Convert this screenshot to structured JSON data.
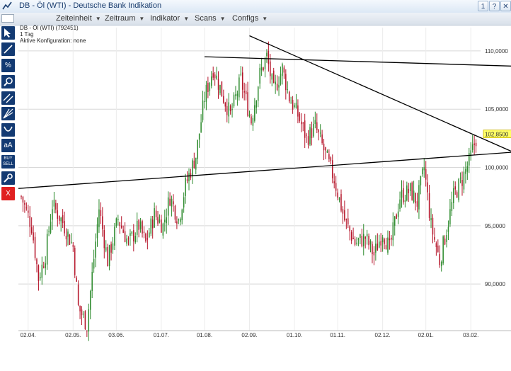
{
  "window": {
    "title": "DB - Öl (WTI) - Deutsche Bank Indikation",
    "badge": "1",
    "help_label": "?",
    "close_label": "✕"
  },
  "menu": {
    "items": [
      {
        "label": "Zeiteinheit"
      },
      {
        "label": "Zeitraum"
      },
      {
        "label": "Indikator"
      },
      {
        "label": "Scans"
      },
      {
        "label": "Configs"
      }
    ],
    "arrow_glyph": "▼"
  },
  "toolbar": {
    "percent_glyph": "%",
    "text_tool_glyph": "aA",
    "buy_label": "BUY",
    "sell_label": "SELL",
    "delete_glyph": "X",
    "delete_color": "#e02020",
    "tool_color": "#133a72"
  },
  "chart_info": {
    "line1": "DB - Öl (WTI) (792451)",
    "line2": "1 Tag",
    "line3": "Aktive Konfiguration: none"
  },
  "chart_data": {
    "type": "candlestick",
    "price_axis_labels": [
      "110,0000",
      "105,0000",
      "100,0000",
      "95,0000",
      "90,0000"
    ],
    "price_ticks": [
      110,
      105,
      100,
      95,
      90
    ],
    "y_range": [
      86,
      112
    ],
    "x_ticks": [
      "02.04.",
      "02.05.",
      "03.06.",
      "01.07.",
      "01.08.",
      "02.09.",
      "01.10.",
      "01.11.",
      "02.12.",
      "02.01.",
      "03.02."
    ],
    "current_price_label": "102,8500",
    "current_price": 102.85,
    "up_color": "#2e8b2e",
    "down_color": "#b5152a",
    "grid": true,
    "trendlines": [
      {
        "from": {
          "x": "start",
          "y": 98.2
        },
        "to": {
          "x": "end",
          "y": 101.3
        }
      },
      {
        "from": {
          "x": "01.08.",
          "y": 109.5
        },
        "to": {
          "x": "end",
          "y": 108.7
        }
      },
      {
        "from": {
          "x": "02.09.",
          "y": 111.3
        },
        "to": {
          "x": "end",
          "y": 101.4
        }
      }
    ],
    "close_path": [
      [
        0,
        97.5
      ],
      [
        6,
        95.0
      ],
      [
        10,
        90.5
      ],
      [
        14,
        92.5
      ],
      [
        18,
        96.8
      ],
      [
        24,
        95.3
      ],
      [
        30,
        93.2
      ],
      [
        33,
        88.0
      ],
      [
        38,
        86.5
      ],
      [
        45,
        96.5
      ],
      [
        50,
        92.0
      ],
      [
        56,
        95.6
      ],
      [
        62,
        93.5
      ],
      [
        68,
        95.0
      ],
      [
        72,
        93.5
      ],
      [
        77,
        96.0
      ],
      [
        82,
        95.0
      ],
      [
        86,
        97.5
      ],
      [
        91,
        95.5
      ],
      [
        95,
        98.5
      ],
      [
        101,
        101.0
      ],
      [
        106,
        106.0
      ],
      [
        111,
        108.5
      ],
      [
        117,
        106.0
      ],
      [
        121,
        104.5
      ],
      [
        127,
        107.5
      ],
      [
        133,
        104.0
      ],
      [
        138,
        108.0
      ],
      [
        142,
        109.5
      ],
      [
        146,
        106.5
      ],
      [
        151,
        108.5
      ],
      [
        155,
        106.0
      ],
      [
        160,
        104.5
      ],
      [
        165,
        102.5
      ],
      [
        170,
        103.5
      ],
      [
        175,
        101.5
      ],
      [
        181,
        99.0
      ],
      [
        187,
        95.5
      ],
      [
        193,
        93.5
      ],
      [
        199,
        94.0
      ],
      [
        204,
        92.5
      ],
      [
        209,
        94.5
      ],
      [
        213,
        93.0
      ],
      [
        219,
        97.5
      ],
      [
        225,
        98.0
      ],
      [
        229,
        97.0
      ],
      [
        233,
        100.0
      ],
      [
        237,
        95.0
      ],
      [
        242,
        92.0
      ],
      [
        245,
        94.0
      ],
      [
        250,
        97.5
      ],
      [
        255,
        99.0
      ],
      [
        259,
        100.5
      ],
      [
        263,
        102.5
      ]
    ]
  }
}
